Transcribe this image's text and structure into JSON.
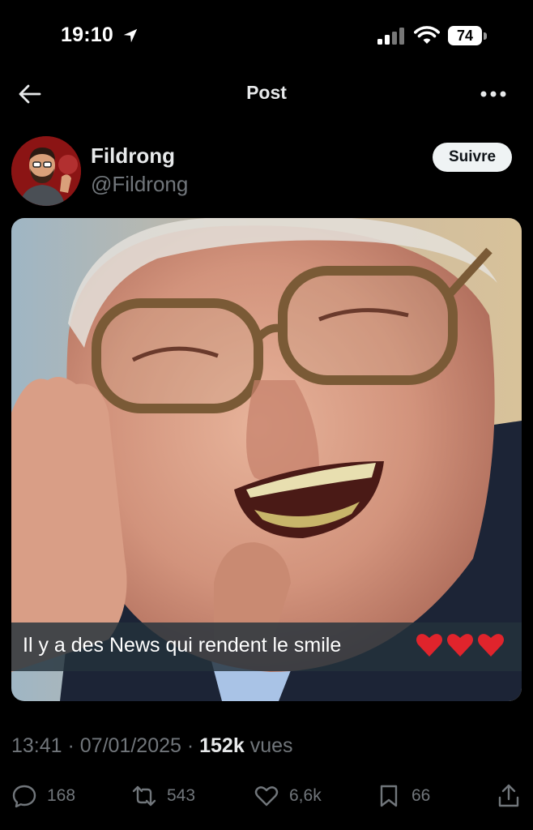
{
  "status_bar": {
    "time": "19:10",
    "battery": "74"
  },
  "nav": {
    "title": "Post"
  },
  "author": {
    "name": "Fildrong",
    "handle": "@Fildrong",
    "follow_label": "Suivre"
  },
  "media": {
    "caption": "Il y a des News qui rendent le smile"
  },
  "meta": {
    "time": "13:41",
    "separator": " · ",
    "date": "07/01/2025",
    "views_count": "152k",
    "views_label": "vues"
  },
  "actions": {
    "replies": "168",
    "reposts": "543",
    "likes": "6,6k",
    "bookmarks": "66"
  },
  "colors": {
    "background": "#000000",
    "text": "#e7e9ea",
    "muted": "#71767b",
    "follow_bg": "#eff3f4",
    "heart": "#e0242c"
  },
  "icons": [
    "location-arrow-icon",
    "cellular-signal-icon",
    "wifi-icon",
    "back-arrow-icon",
    "more-icon",
    "reply-icon",
    "repost-icon",
    "like-icon",
    "bookmark-icon",
    "share-icon"
  ]
}
